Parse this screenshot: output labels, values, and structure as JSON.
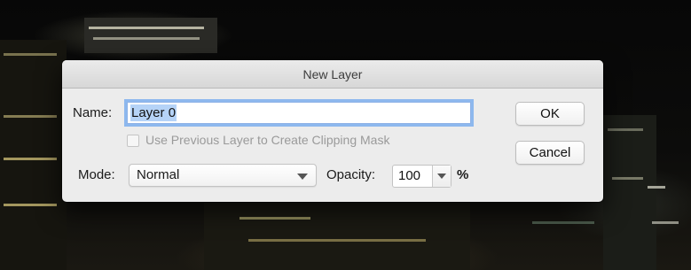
{
  "dialog": {
    "title": "New Layer",
    "name_label": "Name:",
    "name_value": "Layer 0",
    "clipping_checkbox_label": "Use Previous Layer to Create Clipping Mask",
    "clipping_checked": false,
    "mode_label": "Mode:",
    "mode_value": "Normal",
    "opacity_label": "Opacity:",
    "opacity_value": "100",
    "opacity_unit": "%",
    "ok_label": "OK",
    "cancel_label": "Cancel"
  },
  "colors": {
    "dialog_bg": "#ececec",
    "focus_ring": "#8db8ee",
    "selection": "#b5d3f7",
    "disabled_text": "#9a9a9a"
  },
  "icons": {
    "mode_dropdown": "chevron-down-icon",
    "opacity_dropdown": "chevron-down-icon"
  }
}
